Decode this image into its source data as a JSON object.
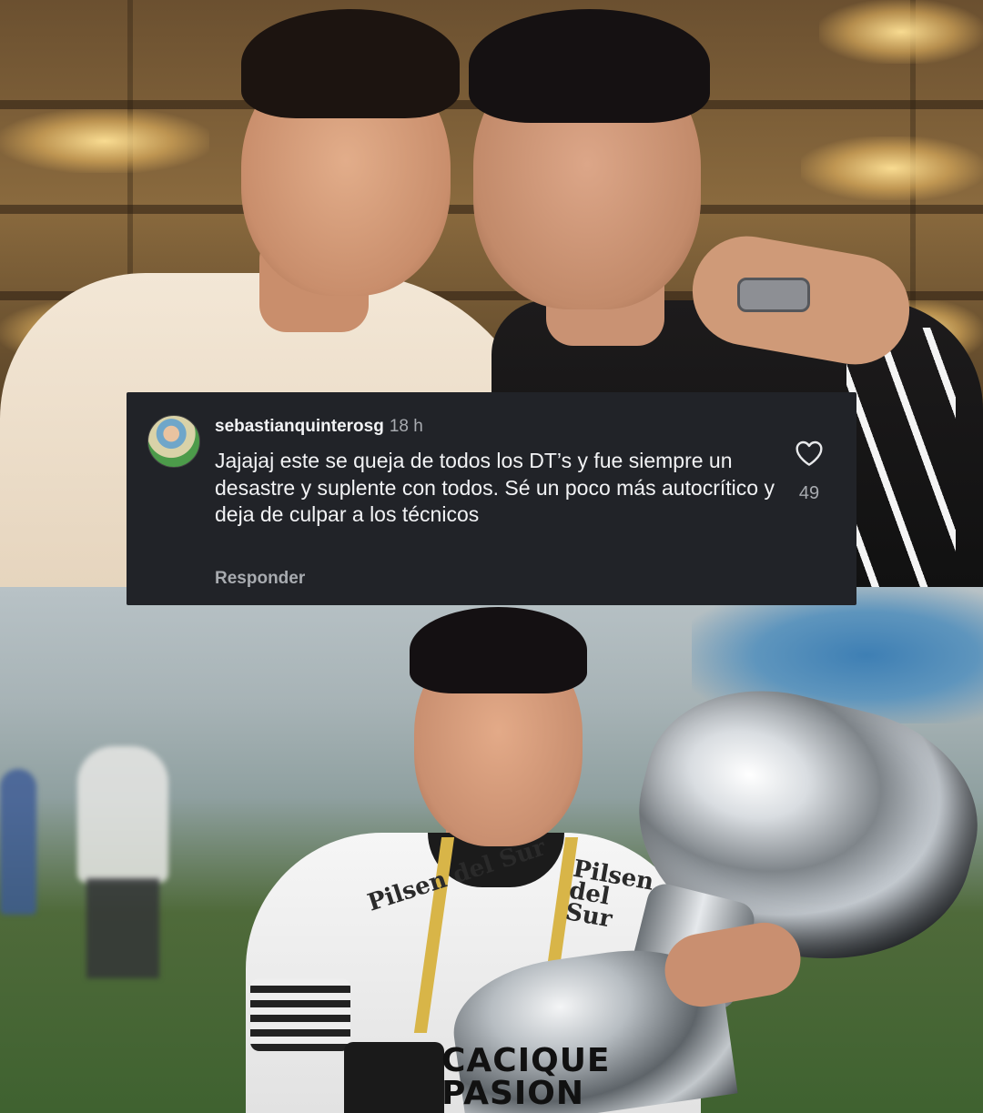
{
  "comment": {
    "username": "sebastianquinterosg",
    "timestamp": "18 h",
    "text": "Jajajaj este se queja de todos los DT’s y fue siempre un desastre y suplente con todos. Sé un poco más autocrítico y deja de culpar a los técnicos",
    "reply_label": "Responder",
    "like_count": "49",
    "like_icon": "heart-outline-icon",
    "colors": {
      "card_bg": "#212328",
      "primary_text": "#f2f3f5",
      "secondary_text": "#a8abb0"
    }
  },
  "bottom_photo": {
    "jersey_sponsor": "Pilsen del Sur",
    "watermark": "CACIQUE PASION"
  }
}
